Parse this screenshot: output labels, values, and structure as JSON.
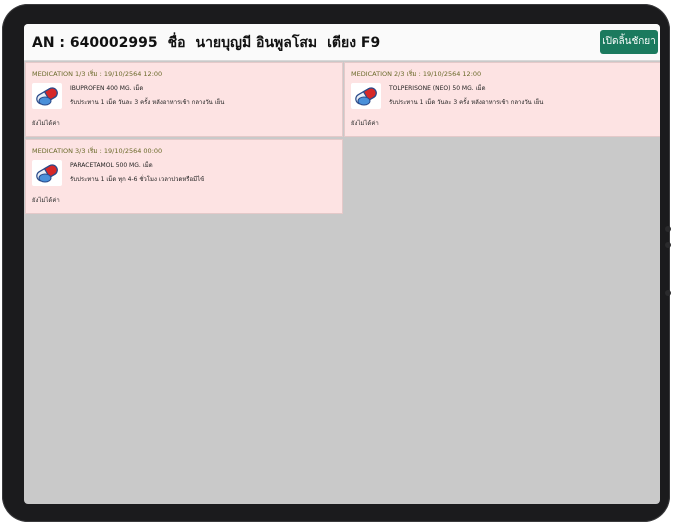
{
  "header": {
    "an_label": "AN : 640002995",
    "name_label": "ชื่อ",
    "patient_name": "นายบุญมี อินพูลโสม",
    "bed_label": "เตียง F9",
    "open_button": "เปิดลิ้นชักยา"
  },
  "medications": [
    {
      "header": "MEDICATION 1/3 เริ่ม : 19/10/2564 12:00",
      "drug": "IBUPROFEN 400 MG. เม็ด",
      "instruction": "รับประทาน 1 เม็ด วันละ 3 ครั้ง หลังอาหารเช้า กลางวัน เย็น",
      "status": "ยังไม่ได้ค่า",
      "icon": "pill-capsule-icon"
    },
    {
      "header": "MEDICATION 2/3 เริ่ม : 19/10/2564 12:00",
      "drug": "TOLPERISONE (NEO) 50 MG. เม็ด",
      "instruction": "รับประทาน 1 เม็ด วันละ 3 ครั้ง หลังอาหารเช้า กลางวัน เย็น",
      "status": "ยังไม่ได้ค่า",
      "icon": "pill-capsule-icon"
    },
    {
      "header": "MEDICATION 3/3 เริ่ม : 19/10/2564 00:00",
      "drug": "PARACETAMOL 500 MG. เม็ด",
      "instruction": "รับประทาน 1 เม็ด ทุก 4-6 ชั่วโมง เวลาปวดหรือมีไข้",
      "status": "ยังไม่ได้ค่า",
      "icon": "pill-capsule-icon"
    }
  ],
  "colors": {
    "card_bg": "#fde3e3",
    "button_bg": "#1b7a5e",
    "screen_bg": "#c9c9c9"
  }
}
